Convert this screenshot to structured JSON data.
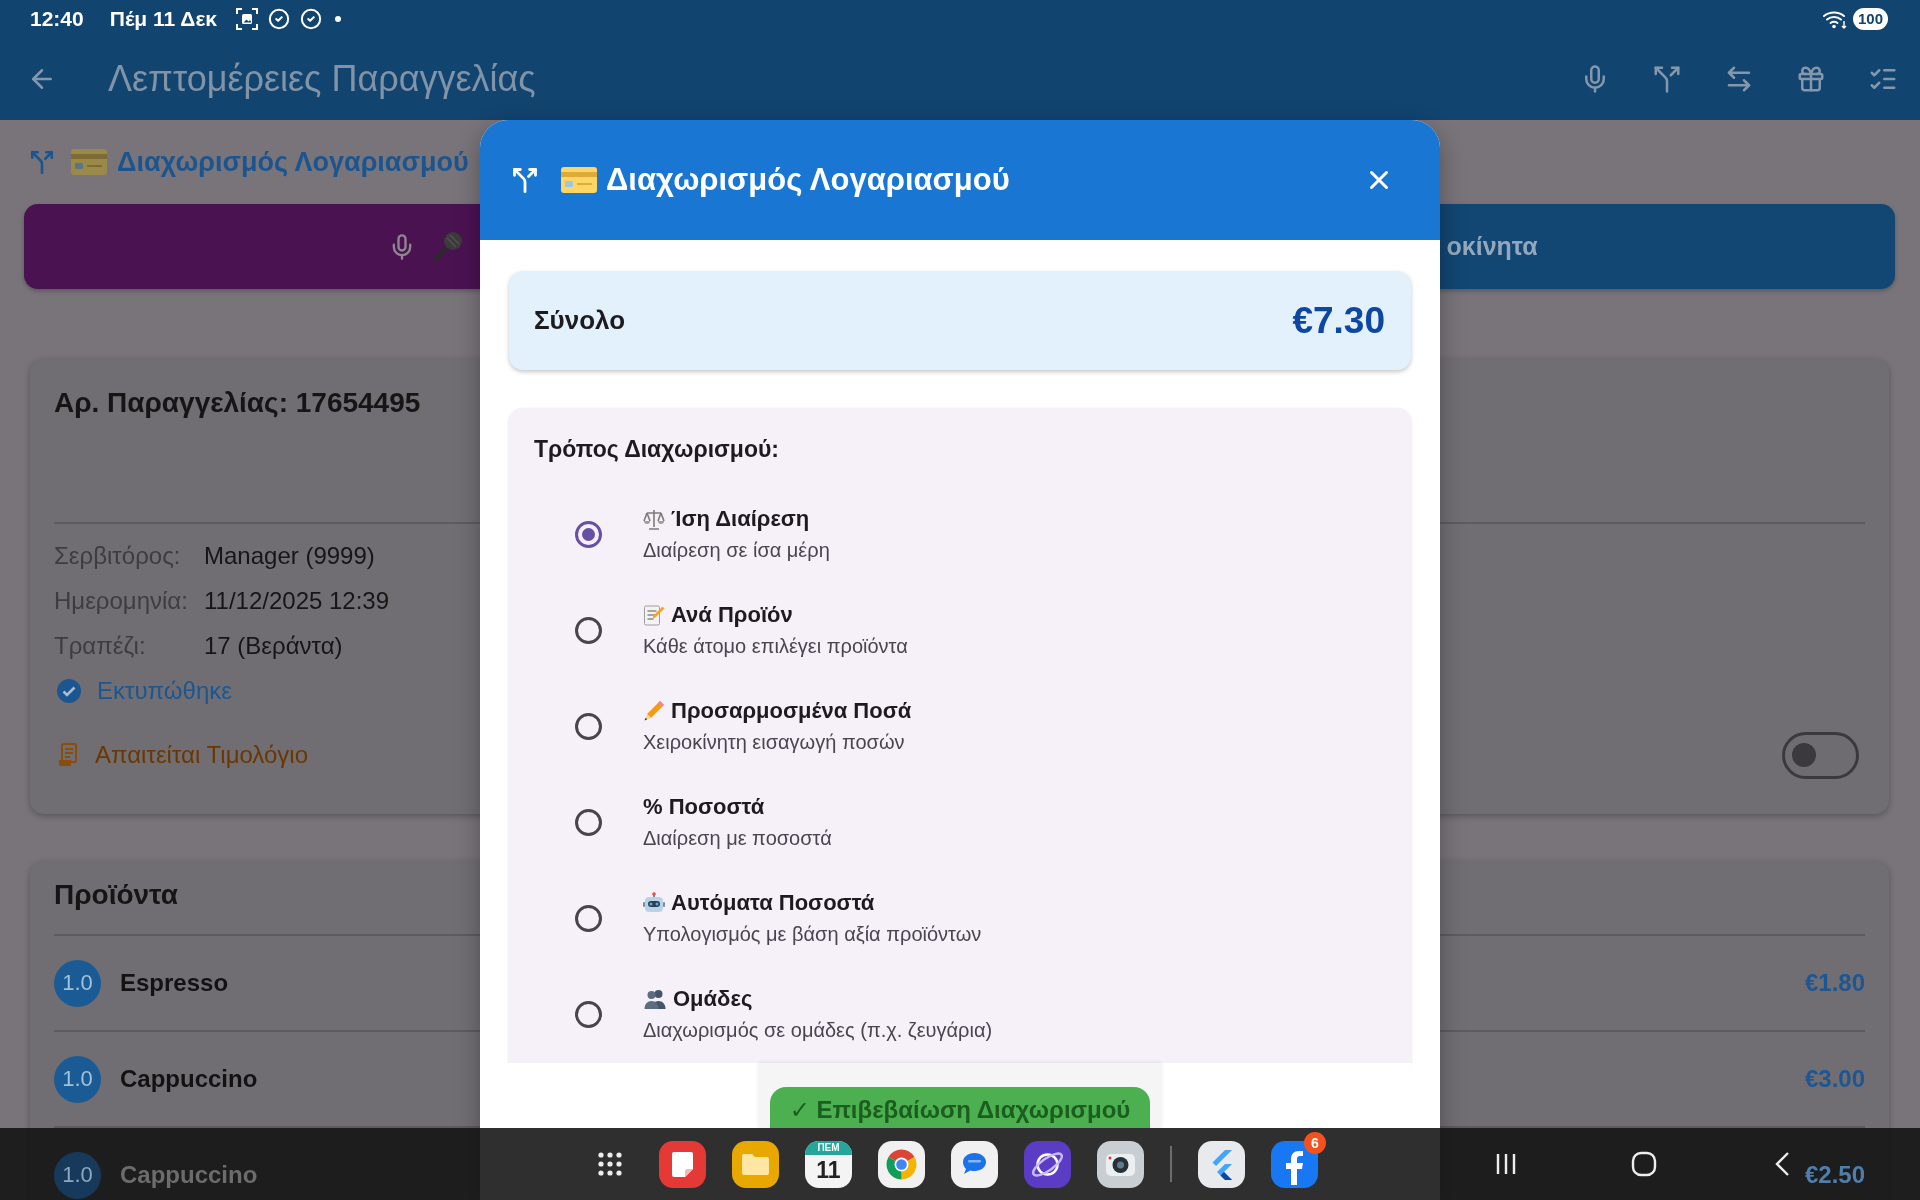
{
  "status_bar": {
    "time": "12:40",
    "date": "Πέμ 11 Δεκ",
    "battery": "100"
  },
  "app_bar": {
    "title": "Λεπτομέρειες Παραγγελίας"
  },
  "section": {
    "title": "Διαχωρισμός Λογαριασμού"
  },
  "action_buttons": [
    {
      "kind": "voice"
    },
    {
      "kind": "label",
      "label": "οκίνητα"
    }
  ],
  "order": {
    "title": "Αρ. Παραγγελίας: 17654495",
    "details": [
      {
        "label": "Σερβιτόρος:",
        "value": "Manager (9999)"
      },
      {
        "label": "Ημερομηνία:",
        "value": "11/12/2025 12:39"
      },
      {
        "label": "Τραπέζι:",
        "value": "17 (Βεράντα)"
      }
    ],
    "printed": "Εκτυπώθηκε",
    "invoice": {
      "label": "Απαιτείται Τιμολόγιο",
      "on": false
    }
  },
  "products": {
    "title": "Προϊόντα",
    "rows": [
      {
        "quantity": "1.0",
        "name": "Espresso",
        "price": "€1.80"
      },
      {
        "quantity": "1.0",
        "name": "Cappuccino",
        "price": "€3.00"
      },
      {
        "quantity": "1.0",
        "name": "Cappuccino",
        "price": "€2.50"
      }
    ]
  },
  "dialog": {
    "title": "Διαχωρισμός Λογαριασμού",
    "total": {
      "label": "Σύνολο",
      "amount": "€7.30"
    },
    "methods": {
      "title": "Τρόπος Διαχωρισμού:",
      "options": [
        {
          "kind": "scale",
          "title": "Ίση Διαίρεση",
          "subtitle": "Διαίρεση σε ίσα μέρη",
          "selected": true
        },
        {
          "kind": "memo",
          "title": "Ανά Προϊόν",
          "subtitle": "Κάθε άτομο επιλέγει προϊόντα",
          "selected": false
        },
        {
          "kind": "pencil",
          "title": "Προσαρμοσμένα Ποσά",
          "subtitle": "Χειροκίνητη εισαγωγή ποσών",
          "selected": false
        },
        {
          "kind": "plain",
          "title": "% Ποσοστά",
          "subtitle": "Διαίρεση με ποσοστά",
          "selected": false
        },
        {
          "kind": "robot",
          "title": "Αυτόματα Ποσοστά",
          "subtitle": "Υπολογισμός με βάση αξία προϊόντων",
          "selected": false
        },
        {
          "kind": "people",
          "title": "Ομάδες",
          "subtitle": "Διαχωρισμός σε ομάδες (π.χ. ζευγάρια)",
          "selected": false
        }
      ]
    },
    "confirm_button": "✓ Επιβεβαίωση Διαχωρισμού"
  },
  "dock": {
    "calendar": {
      "weekday": "ΠΕΜ",
      "day": "11"
    },
    "badge": "6"
  }
}
